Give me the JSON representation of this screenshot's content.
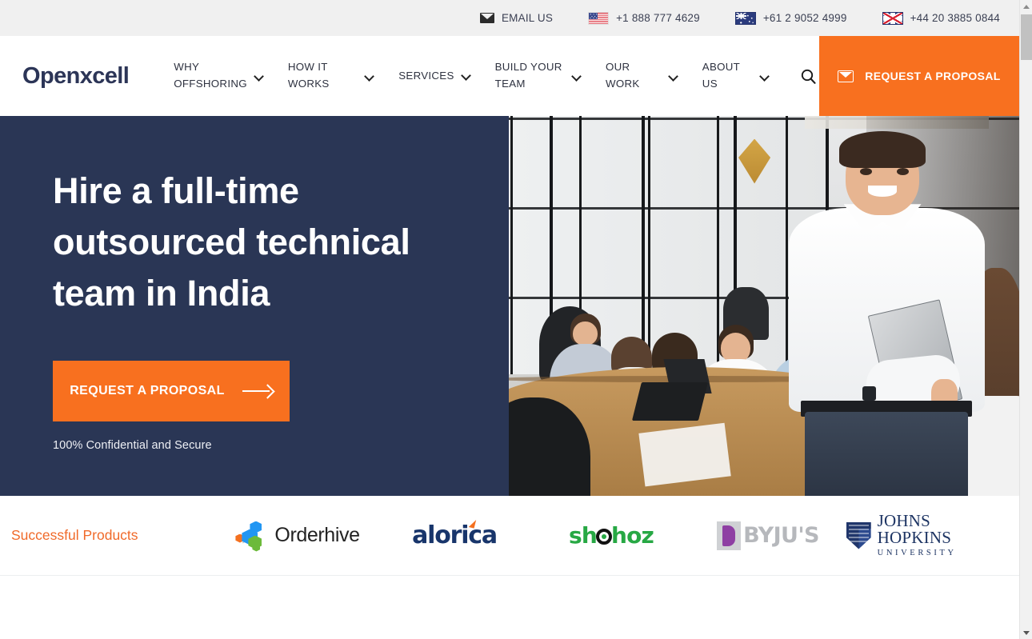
{
  "topbar": {
    "email_label": "EMAIL US",
    "contacts": [
      {
        "flag": "us-flag-icon",
        "phone": "+1 888 777 4629"
      },
      {
        "flag": "au-flag-icon",
        "phone": "+61 2 9052 4999"
      },
      {
        "flag": "uk-flag-icon",
        "phone": "+44 20 3885 0844"
      }
    ]
  },
  "header": {
    "logo": "Openxcell",
    "nav": [
      {
        "label": "WHY OFFSHORING",
        "has_dropdown": true
      },
      {
        "label": "HOW IT WORKS",
        "has_dropdown": true
      },
      {
        "label": "SERVICES",
        "has_dropdown": true
      },
      {
        "label": "BUILD YOUR TEAM",
        "has_dropdown": true
      },
      {
        "label": "OUR WORK",
        "has_dropdown": true
      },
      {
        "label": "ABOUT US",
        "has_dropdown": true
      }
    ],
    "search_icon": "search-icon",
    "cta_label": "REQUEST A PROPOSAL",
    "cta_icon": "envelope-icon"
  },
  "hero": {
    "title": "Hire a full-time outsourced technical team in India",
    "cta_label": "REQUEST A PROPOSAL",
    "cta_icon": "arrow-right-icon",
    "note": "100% Confidential and Secure",
    "image_alt": "office-team-meeting-photo"
  },
  "brands": {
    "label": "Successful Products",
    "items": [
      {
        "name": "Orderhive"
      },
      {
        "name": "alorica"
      },
      {
        "name": "shohoz"
      },
      {
        "name": "BYJU'S"
      },
      {
        "name": "JOHNS HOPKINS",
        "sub": "UNIVERSITY"
      }
    ]
  },
  "colors": {
    "navy": "#2a3655",
    "orange": "#f8701f",
    "brand_label_orange": "#f06a2a",
    "topbar_bg": "#f0f0f0",
    "logo_navy": "#2c3557"
  }
}
